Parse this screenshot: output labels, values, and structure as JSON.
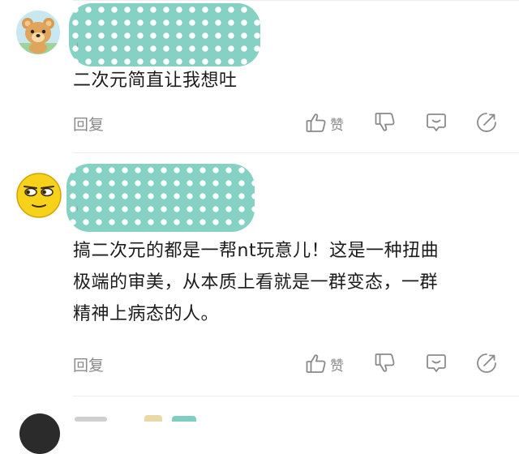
{
  "comments": [
    {
      "text_lines": [
        "二次元简直让我想吐"
      ],
      "actions": {
        "reply": "回复",
        "like": "赞"
      }
    },
    {
      "text_lines": [
        "搞二次元的都是一帮nt玩意儿！这是一种扭曲",
        "极端的审美，从本质上看就是一群变态，一群",
        "精神上病态的人。"
      ],
      "actions": {
        "reply": "回复",
        "like": "赞"
      }
    }
  ],
  "icons": {
    "like": "thumbs-up-icon",
    "dislike": "thumbs-down-icon",
    "message": "message-bubble-icon",
    "share": "share-icon"
  },
  "colors": {
    "name_blur": "#7fcfc0",
    "action_text": "#8a8a8a",
    "body_text": "#1c1c1c",
    "divider": "#eeeeee"
  }
}
